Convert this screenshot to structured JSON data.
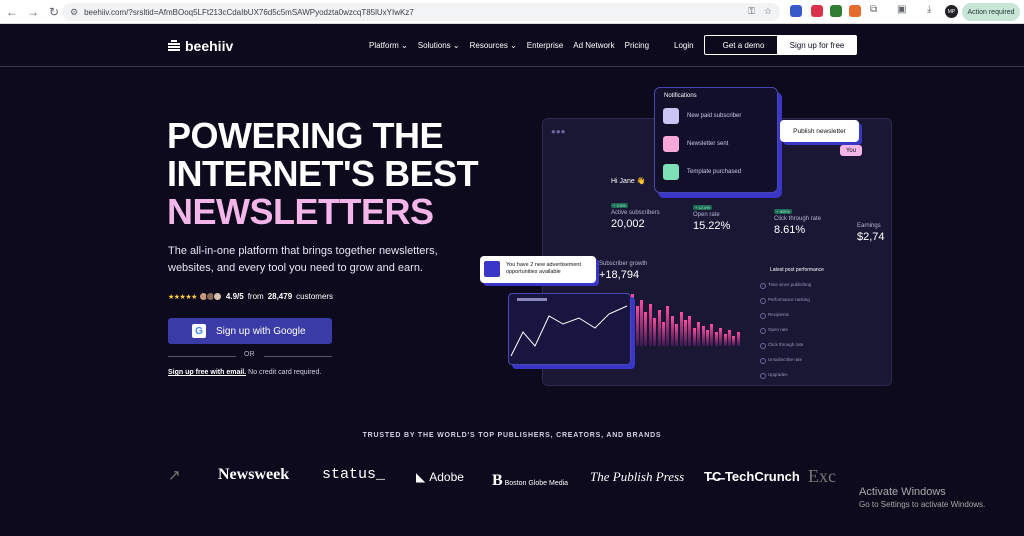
{
  "browser": {
    "url": "beehiiv.com/?srsltid=AfmBOoq5LFt213cCdaIbUX76d5c5mSAWPyodzta0wzcqT85lUxYIwKz7",
    "action_label": "Action required",
    "profile_initials": "MP"
  },
  "nav": {
    "logo": "beehiiv",
    "menu": [
      "Platform",
      "Solutions",
      "Resources",
      "Enterprise",
      "Ad Network",
      "Pricing"
    ],
    "login": "Login",
    "demo": "Get a demo",
    "signup": "Sign up for free"
  },
  "hero": {
    "line1": "POWERING THE",
    "line2": "INTERNET'S BEST",
    "line3": "NEWSLETTERS",
    "subtitle": "The all-in-one platform that brings together newsletters, websites, and every tool you need to grow and earn.",
    "stars": "★★★★★",
    "rating": "4.9/5",
    "from": "from",
    "customers_count": "28,479",
    "customers": "customers",
    "google_btn": "Sign up with Google",
    "or": "OR",
    "email_link": "Sign up free with email.",
    "no_card": "No credit card required."
  },
  "illustration": {
    "notifications_title": "Notifications",
    "notifications": [
      "New paid subscriber",
      "Newsletter sent",
      "Template purchased"
    ],
    "publish": "Publish newsletter",
    "you": "You",
    "greeting": "Hi Jane 👋",
    "metrics": [
      {
        "tag": "+ 3.6%",
        "label": "Active subscribers",
        "value": "20,002"
      },
      {
        "tag": "+ 12.4%",
        "label": "Open rate",
        "value": "15.22%"
      },
      {
        "tag": "+ 300%",
        "label": "Click through rate",
        "value": "8.61%"
      },
      {
        "label": "Earnings",
        "value": "$2,74"
      }
    ],
    "ad_text": "You have 2 new advertisement opportunities available",
    "growth_label": "Subscriber growth",
    "growth_value": "+18,794",
    "perf_title": "Latest post performance",
    "perf_items": [
      "Time since publishing",
      "Performance ranking",
      "Recipients",
      "Open rate",
      "Click through rate",
      "Unsubscribe rate",
      "Upgrades"
    ]
  },
  "trusted": "TRUSTED BY THE WORLD'S TOP PUBLISHERS, CREATORS, AND BRANDS",
  "logos": [
    "Newsweek",
    "status_",
    "Adobe",
    "Boston Globe Media",
    "The Publish Press",
    "TechCrunch"
  ],
  "watermark": {
    "line1": "Activate Windows",
    "line2": "Go to Settings to activate Windows."
  }
}
